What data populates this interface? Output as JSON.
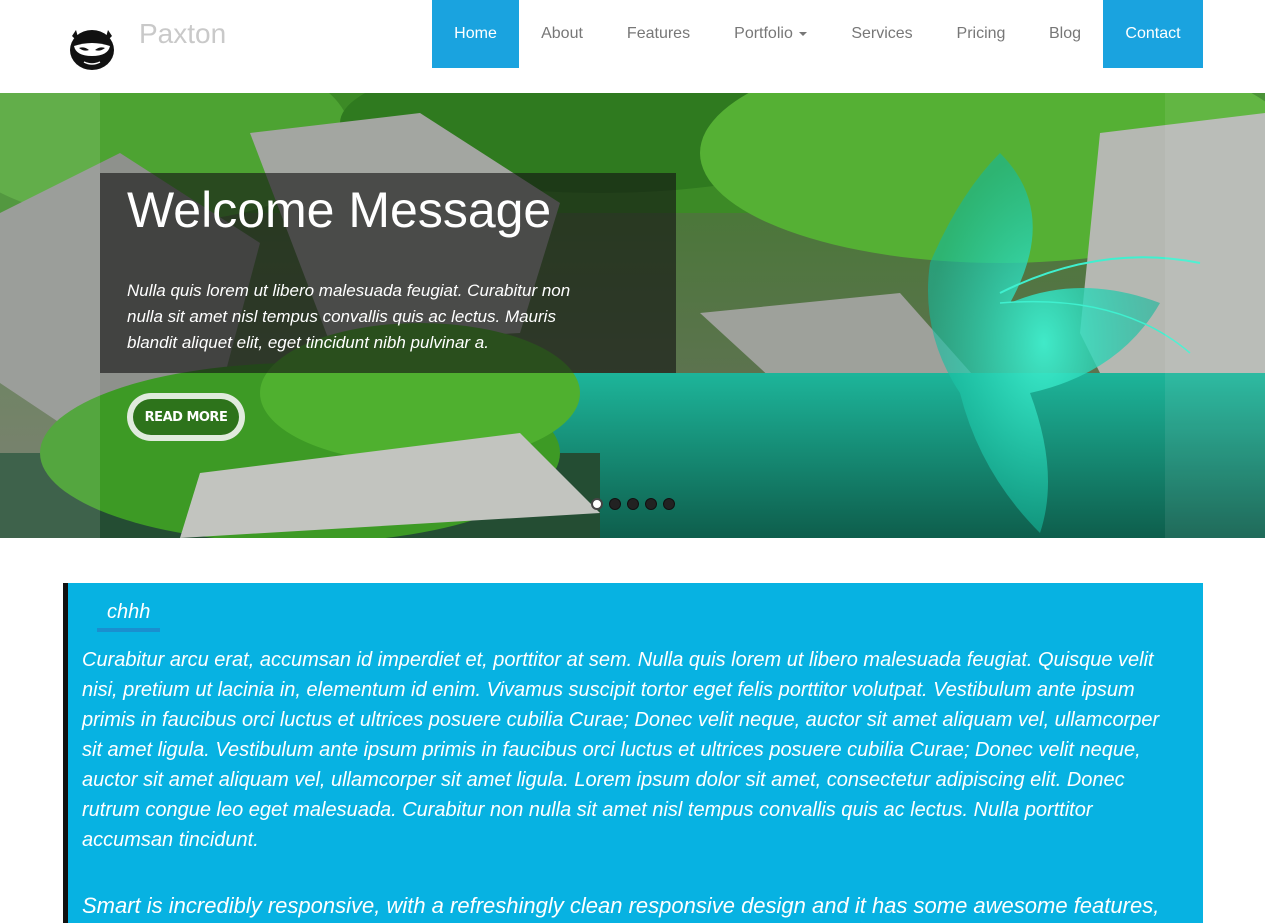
{
  "brand": {
    "name": "Paxton",
    "logo_icon": "ninja-mask-icon"
  },
  "nav": {
    "items": [
      {
        "label": "Home",
        "active": true
      },
      {
        "label": "About",
        "active": false
      },
      {
        "label": "Features",
        "active": false
      },
      {
        "label": "Portfolio",
        "active": false,
        "dropdown": true
      },
      {
        "label": "Services",
        "active": false
      },
      {
        "label": "Pricing",
        "active": false
      },
      {
        "label": "Blog",
        "active": false
      },
      {
        "label": "Contact",
        "active": true
      }
    ],
    "accent_color": "#1aa3df"
  },
  "hero": {
    "title": "Welcome Message",
    "text": "Nulla quis lorem ut libero malesuada feugiat. Curabitur non nulla sit amet nisl tempus convallis quis ac lectus. Mauris blandit aliquet elit, eget tincidunt nibh pulvinar a.",
    "button_label": "Read More",
    "slides": 5,
    "active_slide": 1
  },
  "content": {
    "title": "chhh",
    "paragraph": "Curabitur arcu erat, accumsan id imperdiet et, porttitor at sem. Nulla quis lorem ut libero malesuada feugiat. Quisque velit nisi, pretium ut lacinia in, elementum id enim. Vivamus suscipit tortor eget felis porttitor volutpat. Vestibulum ante ipsum primis in faucibus orci luctus et ultrices posuere cubilia Curae; Donec velit neque, auctor sit amet aliquam vel, ullamcorper sit amet ligula. Vestibulum ante ipsum primis in faucibus orci luctus et ultrices posuere cubilia Curae; Donec velit neque, auctor sit amet aliquam vel, ullamcorper sit amet ligula. Lorem ipsum dolor sit amet, consectetur adipiscing elit. Donec rutrum congue leo eget malesuada. Curabitur non nulla sit amet nisl tempus convallis quis ac lectus. Nulla porttitor accumsan tincidunt.",
    "paragraph2": "Smart is incredibly responsive, with a refreshingly clean responsive design and it has some awesome features,",
    "background_color": "#07b2e2"
  }
}
